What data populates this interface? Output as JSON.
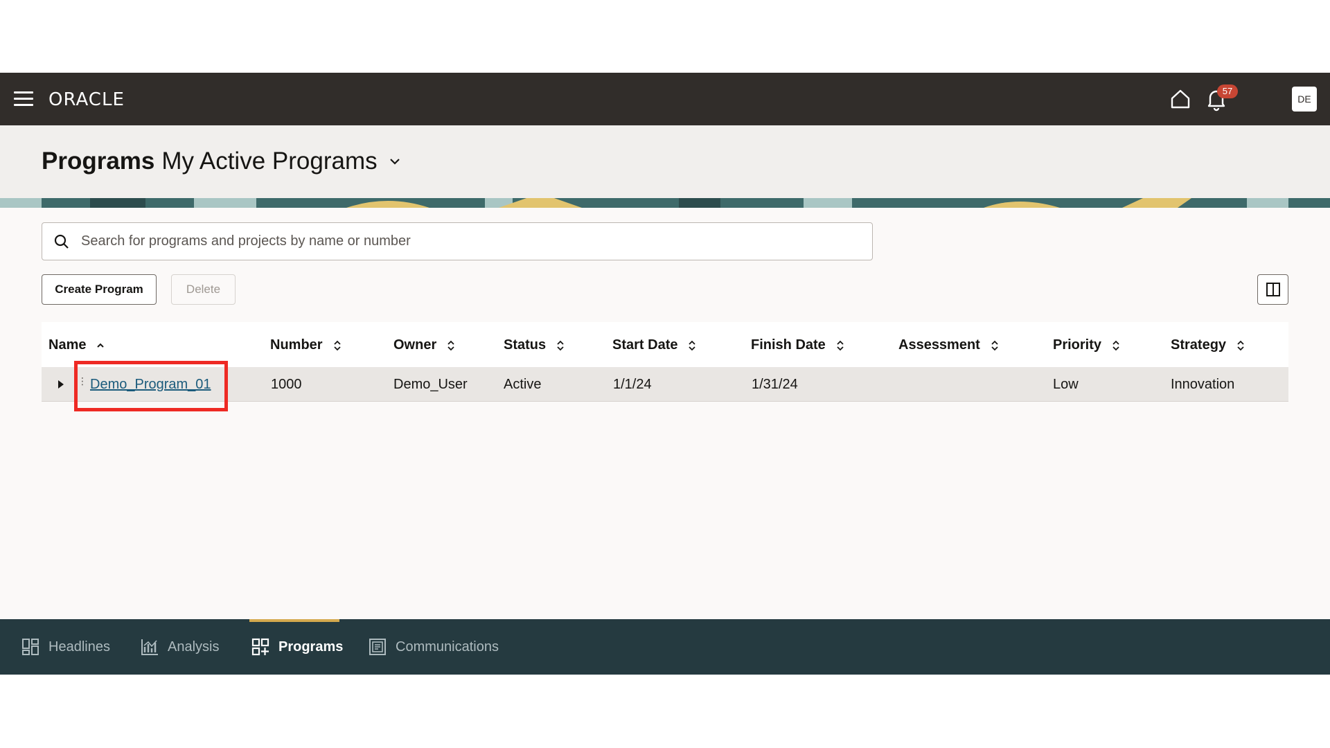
{
  "header": {
    "logo": "ORACLE",
    "notification_count": "57",
    "avatar_initials": "DE"
  },
  "page": {
    "title": "Programs",
    "subtitle": "My Active Programs"
  },
  "search": {
    "placeholder": "Search for programs and projects by name or number"
  },
  "toolbar": {
    "create_label": "Create Program",
    "delete_label": "Delete"
  },
  "table": {
    "columns": [
      "Name",
      "Number",
      "Owner",
      "Status",
      "Start Date",
      "Finish Date",
      "Assessment",
      "Priority",
      "Strategy"
    ],
    "rows": [
      {
        "name": "Demo_Program_01",
        "number": "1000",
        "owner": "Demo_User",
        "status": "Active",
        "start_date": "1/1/24",
        "finish_date": "1/31/24",
        "assessment": "",
        "priority": "Low",
        "strategy": "Innovation"
      }
    ]
  },
  "bottom_nav": {
    "items": [
      {
        "label": "Headlines",
        "icon": "headlines-icon"
      },
      {
        "label": "Analysis",
        "icon": "analysis-icon"
      },
      {
        "label": "Programs",
        "icon": "programs-icon"
      },
      {
        "label": "Communications",
        "icon": "communications-icon"
      }
    ],
    "active": "Programs"
  },
  "colors": {
    "appbar": "#312d2a",
    "bottom_nav": "#253a40",
    "highlight": "#ee2a24",
    "link": "#1b5b7c",
    "badge": "#c74634",
    "active_tab": "#d4a94e"
  }
}
